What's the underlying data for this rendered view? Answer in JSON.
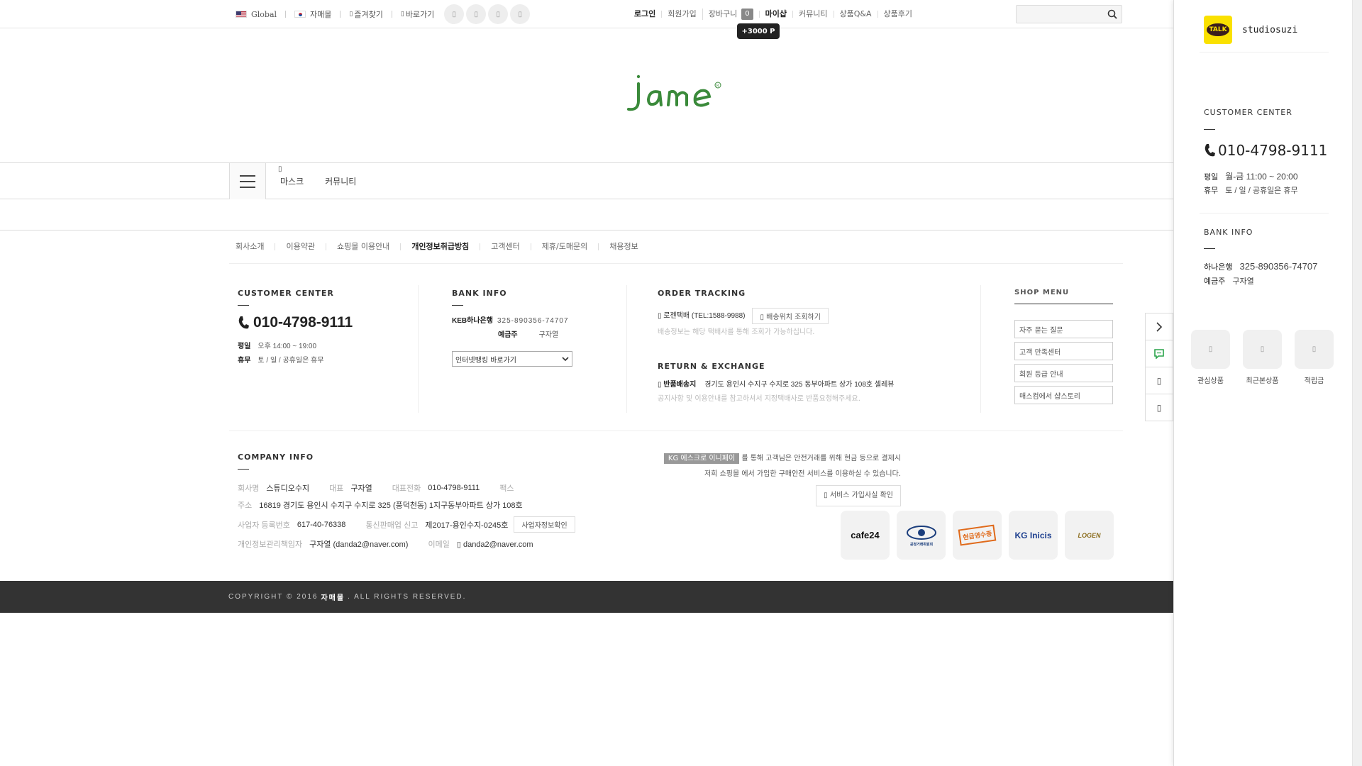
{
  "topbar": {
    "global": "Global",
    "mall": "자매몰",
    "bookmark": "즐겨찾기",
    "shortcut": "바로가기",
    "login": "로그인",
    "join": "회원가입",
    "cart": "장바구니",
    "cart_count": "0",
    "mypage": "마이샵",
    "community": "커뮤니티",
    "qna": "상품Q&A",
    "review": "상품후기",
    "point_tip": "+3000 P",
    "search_placeholder": ""
  },
  "nav": {
    "items": [
      "마스크",
      "커뮤니티"
    ]
  },
  "footer_links": [
    "회사소개",
    "이용약관",
    "쇼핑몰 이용안내",
    "개인정보취급방침",
    "고객센터",
    "제휴/도매문의",
    "채용정보"
  ],
  "customer_center": {
    "title": "CUSTOMER CENTER",
    "phone": "010-4798-9111",
    "weekday_label": "평일",
    "weekday": "오후 14:00 ~ 19:00",
    "holiday_label": "휴무",
    "holiday": "토 / 일 / 공휴일은 휴무"
  },
  "bank_info": {
    "title": "BANK INFO",
    "bank": "KEB하나은행",
    "account": "325-890356-74707",
    "holder_label": "예금주",
    "holder": "구자열",
    "select": "인터넷뱅킹 바로가기"
  },
  "order": {
    "title": "ORDER TRACKING",
    "courier": "로젠택배 (TEL:1588-9988)",
    "track_button": "배송위치 조회하기",
    "note": "배송정보는 해당 택배사를 통해 조회가 가능하십니다.",
    "return_title": "RETURN & EXCHANGE",
    "return_label": "반품배송지",
    "return_addr": "경기도 용인시 수지구 수지로 325 동부아파트 상가 108호 셀레뷰",
    "return_note": "공지사항 및 이용안내를 참고하셔서 지정택배사로 반품요청해주세요."
  },
  "shop_menu": {
    "title": "SHOP MENU",
    "items": [
      "자주 묻는 질문",
      "고객 만족센터",
      "회원 등급 안내",
      "매스컴에서 샵스토리"
    ]
  },
  "company": {
    "title": "COMPANY INFO",
    "name_label": "회사명",
    "name": "스튜디오수지",
    "ceo_label": "대표",
    "ceo": "구자열",
    "tel_label": "대표전화",
    "tel": "010-4798-9111",
    "fax_label": "팩스",
    "addr_label": "주소",
    "addr": "16819 경기도 용인시 수지구 수지로 325 (풍덕천동) 1지구동부아파트 상가 108호",
    "biz_label": "사업자 등록번호",
    "biz": "617-40-76338",
    "mail_order_label": "통신판매업 신고",
    "mail_order": "제2017-용인수지-0245호",
    "biz_check": "사업자정보확인",
    "privacy_label": "개인정보관리책임자",
    "privacy": "구자열 (danda2@naver.com)",
    "email_label": "이메일",
    "email": "danda2@naver.com"
  },
  "escrow": {
    "tag": "KG 에스크로 이니페이",
    "line1": "를 통해 고객님은 안전거래를 위해 현금 등으로 결제시",
    "line2": "저희 쇼핑몰 에서 가입한 구매안전 서비스를 이용하실 수 있습니다.",
    "button": "서비스 가입사실 확인"
  },
  "badges": [
    "cafe24",
    "공정거래위원회",
    "현금영수증",
    "KG Inicis",
    "LOGEN"
  ],
  "copyright": {
    "prefix": "COPYRIGHT © 2016",
    "name": "자매몰",
    "suffix": ". ALL RIGHTS RESERVED."
  },
  "side_panel": {
    "kakao_label": "TALK",
    "kakao_name": "studiosuzi",
    "cc_title": "CUSTOMER CENTER",
    "phone": "010-4798-9111",
    "weekday_label": "평일",
    "weekday": "월-금 11:00 ~ 20:00",
    "holiday_label": "휴무",
    "holiday": "토 / 일 / 공휴일은 휴무",
    "bank_title": "BANK INFO",
    "bank": "하나은행",
    "account": "325-890356-74707",
    "holder_label": "예금주",
    "holder": "구자열",
    "icons": [
      "관심상품",
      "최근본상품",
      "적립금"
    ]
  },
  "colors": {
    "logo_green": "#3a8a3a",
    "copy_bar": "#333333",
    "kakao": "#fae100",
    "chat_green": "#2aa34a"
  }
}
